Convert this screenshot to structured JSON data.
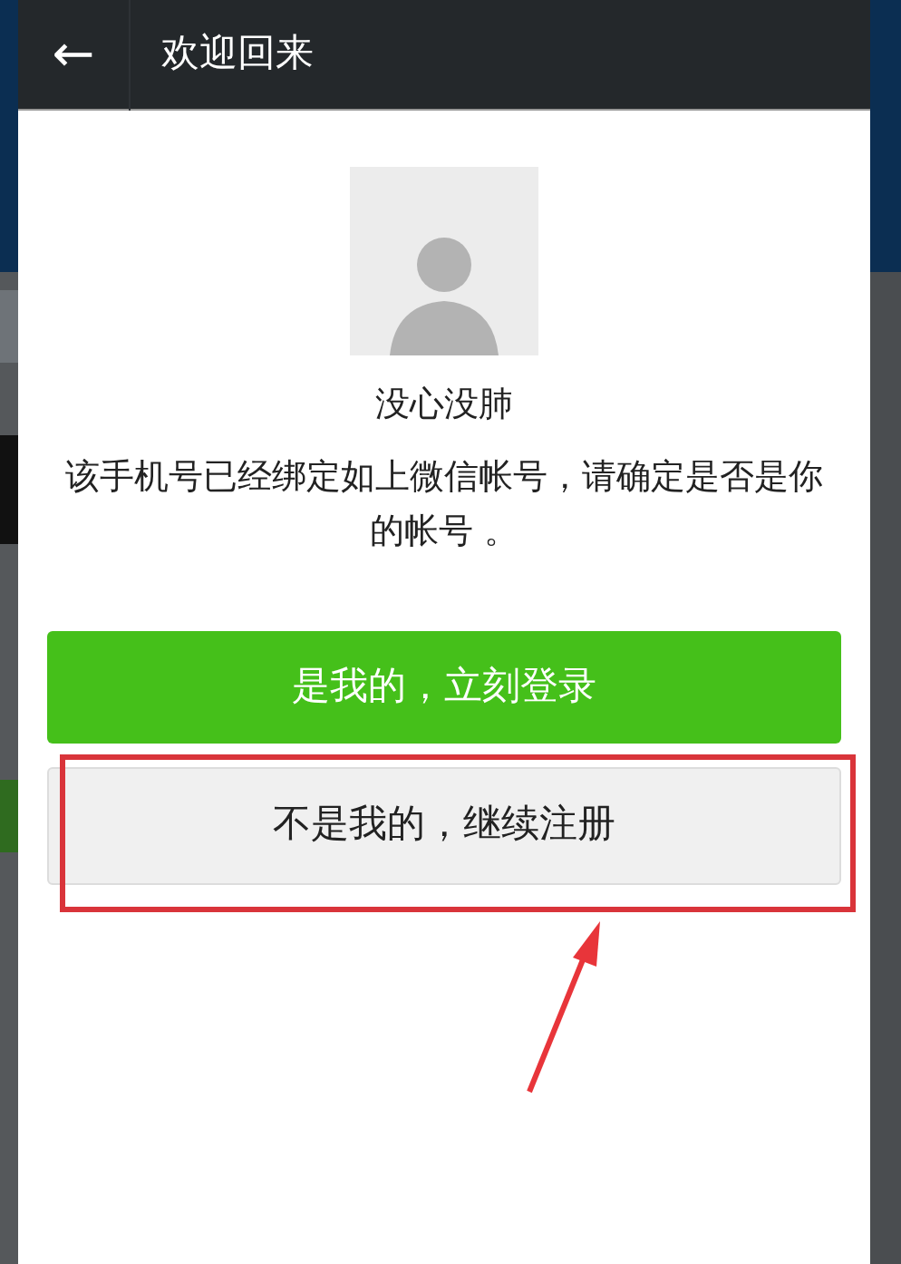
{
  "header": {
    "back_icon": "←",
    "title": "欢迎回来"
  },
  "account": {
    "name": "没心没肺",
    "message": "该手机号已经绑定如上微信帐号，请确定是否是你的帐号 。"
  },
  "buttons": [
    {
      "label": "是我的，立刻登录",
      "kind": "primary",
      "highlighted": false
    },
    {
      "label": "不是我的，继续注册",
      "kind": "secondary",
      "highlighted": true
    }
  ]
}
